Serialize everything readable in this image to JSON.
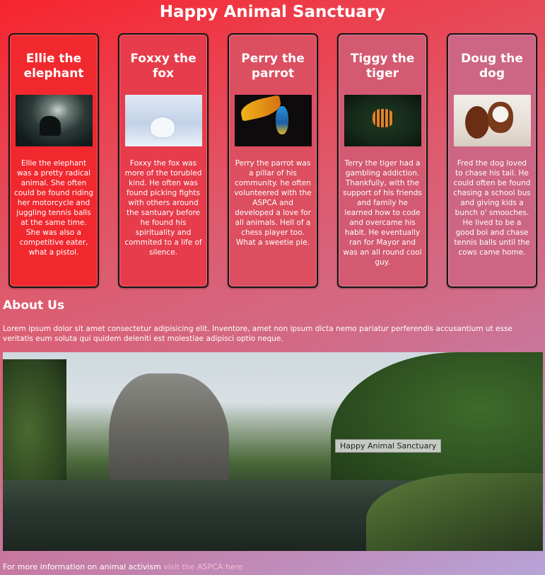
{
  "header": {
    "title": "Happy Animal Sanctuary"
  },
  "cards": [
    {
      "name": "Ellie the elephant",
      "image": "elephant-photo",
      "bg": "#f1292f",
      "text": "Ellie the elephant was a pretty radical animal. She often could be found riding her motorcycle and juggling tennis balls at the same time. She was also a competitive eater, what a pistol."
    },
    {
      "name": "Foxxy the fox",
      "image": "arctic-fox-photo",
      "bg": "#e63c4b",
      "text": "Foxxy the fox was more of the torubled kind. He often was found picking fights with others around the santuary before he found his spirituality and commited to a life of silence."
    },
    {
      "name": "Perry the parrot",
      "image": "parrot-photo",
      "bg": "#dc4f60",
      "text": "Perry the parrot was a pillar of his community. he often volunteered with the ASPCA and developed a love for all animals. Hell of a chess player too. What a sweetie pie."
    },
    {
      "name": "Tiggy the tiger",
      "image": "tiger-photo",
      "bg": "#d35a70",
      "text": "Terry the tiger had a gambling addiction. Thankfully, with the support of his friends and family he learned how to code and overcame his habit. He eventually ran for Mayor and was an all round cool guy."
    },
    {
      "name": "Doug the dog",
      "image": "dog-photo",
      "bg": "#cd6684",
      "text": "Fred the dog loved to chase his tail. He could often be found chasing a school bus and giving kids a bunch o' smooches. He lived to be a good boi and chase tennis balls until the cows came home."
    }
  ],
  "about": {
    "title": "About Us",
    "text": "Lorem ipsum dolor sit amet consectetur adipisicing elit. Inventore, amet non ipsum dicta nemo pariatur perferendis accusantium ut esse veritatis eum soluta qui quidem deleniti est molestiae adipisci optio neque."
  },
  "landscape": {
    "caption": "Happy Animal Sanctuary"
  },
  "footer": {
    "text": "For more information on animal activism ",
    "link_text": "visit the ASPCA here"
  }
}
